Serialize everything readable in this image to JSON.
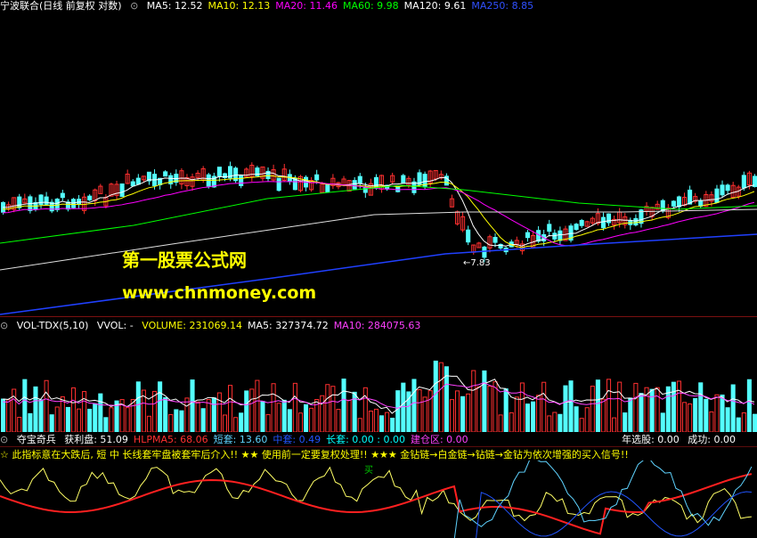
{
  "price": {
    "title": "宁波联合(日线 前复权 对数)",
    "indicators": [
      {
        "text": "MA5: 12.52",
        "color": "#ffffff"
      },
      {
        "text": "MA10: 12.13",
        "color": "#ffff00"
      },
      {
        "text": "MA20: 11.46",
        "color": "#ff00ff"
      },
      {
        "text": "MA60: 9.98",
        "color": "#00ff00"
      },
      {
        "text": "MA120: 9.61",
        "color": "#ffffff"
      },
      {
        "text": "MA250: 8.85",
        "color": "#3050ff"
      }
    ],
    "low_label": "7.83"
  },
  "watermark": {
    "line1": "第一股票公式网",
    "line2": "www.chnmoney.com"
  },
  "volume": {
    "title": "VOL-TDX(5,10)",
    "vvol": "VVOL: -",
    "items": [
      {
        "text": "VOLUME: 231069.14",
        "color": "#ffff00"
      },
      {
        "text": "MA5: 327374.72",
        "color": "#ffffff"
      },
      {
        "text": "MA10: 284075.63",
        "color": "#ff40ff"
      }
    ]
  },
  "indicator": {
    "name": "夺宝奇兵",
    "items": [
      {
        "text": "获利盘: 51.09",
        "color": "#ffffff"
      },
      {
        "text": "HLPMA5: 68.06",
        "color": "#ff3030"
      },
      {
        "text": "短套: 13.60",
        "color": "#5fd3ff"
      },
      {
        "text": "中套: 0.49",
        "color": "#2255ff"
      },
      {
        "text": "长套: 0.00 : 0.00",
        "color": "#00ffff"
      },
      {
        "text": "建仓区: 0.00",
        "color": "#ff40ff"
      }
    ],
    "right_a": "年选股: 0.00",
    "right_b": "成功: 0.00",
    "signal": "☆ 此指标意在大跌后, 短 中 长线套牢盘被套牢后介入!! ★★ 使用前一定要复权处理!! ★★★ 金钻链→白金链→钻链→金钻为依次增强的买入信号!!",
    "mark_buy": "买"
  }
}
